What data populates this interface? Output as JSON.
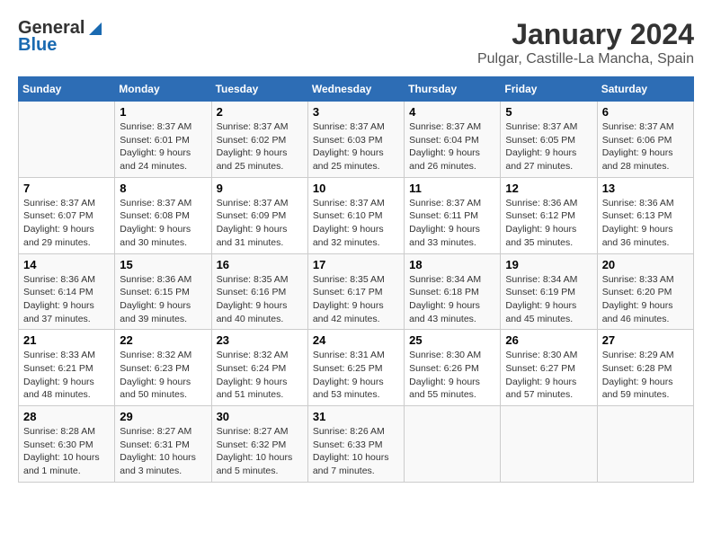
{
  "logo": {
    "general": "General",
    "blue": "Blue"
  },
  "title": "January 2024",
  "subtitle": "Pulgar, Castille-La Mancha, Spain",
  "days_of_week": [
    "Sunday",
    "Monday",
    "Tuesday",
    "Wednesday",
    "Thursday",
    "Friday",
    "Saturday"
  ],
  "weeks": [
    [
      {
        "num": "",
        "sunrise": "",
        "sunset": "",
        "daylight": ""
      },
      {
        "num": "1",
        "sunrise": "Sunrise: 8:37 AM",
        "sunset": "Sunset: 6:01 PM",
        "daylight": "Daylight: 9 hours and 24 minutes."
      },
      {
        "num": "2",
        "sunrise": "Sunrise: 8:37 AM",
        "sunset": "Sunset: 6:02 PM",
        "daylight": "Daylight: 9 hours and 25 minutes."
      },
      {
        "num": "3",
        "sunrise": "Sunrise: 8:37 AM",
        "sunset": "Sunset: 6:03 PM",
        "daylight": "Daylight: 9 hours and 25 minutes."
      },
      {
        "num": "4",
        "sunrise": "Sunrise: 8:37 AM",
        "sunset": "Sunset: 6:04 PM",
        "daylight": "Daylight: 9 hours and 26 minutes."
      },
      {
        "num": "5",
        "sunrise": "Sunrise: 8:37 AM",
        "sunset": "Sunset: 6:05 PM",
        "daylight": "Daylight: 9 hours and 27 minutes."
      },
      {
        "num": "6",
        "sunrise": "Sunrise: 8:37 AM",
        "sunset": "Sunset: 6:06 PM",
        "daylight": "Daylight: 9 hours and 28 minutes."
      }
    ],
    [
      {
        "num": "7",
        "sunrise": "Sunrise: 8:37 AM",
        "sunset": "Sunset: 6:07 PM",
        "daylight": "Daylight: 9 hours and 29 minutes."
      },
      {
        "num": "8",
        "sunrise": "Sunrise: 8:37 AM",
        "sunset": "Sunset: 6:08 PM",
        "daylight": "Daylight: 9 hours and 30 minutes."
      },
      {
        "num": "9",
        "sunrise": "Sunrise: 8:37 AM",
        "sunset": "Sunset: 6:09 PM",
        "daylight": "Daylight: 9 hours and 31 minutes."
      },
      {
        "num": "10",
        "sunrise": "Sunrise: 8:37 AM",
        "sunset": "Sunset: 6:10 PM",
        "daylight": "Daylight: 9 hours and 32 minutes."
      },
      {
        "num": "11",
        "sunrise": "Sunrise: 8:37 AM",
        "sunset": "Sunset: 6:11 PM",
        "daylight": "Daylight: 9 hours and 33 minutes."
      },
      {
        "num": "12",
        "sunrise": "Sunrise: 8:36 AM",
        "sunset": "Sunset: 6:12 PM",
        "daylight": "Daylight: 9 hours and 35 minutes."
      },
      {
        "num": "13",
        "sunrise": "Sunrise: 8:36 AM",
        "sunset": "Sunset: 6:13 PM",
        "daylight": "Daylight: 9 hours and 36 minutes."
      }
    ],
    [
      {
        "num": "14",
        "sunrise": "Sunrise: 8:36 AM",
        "sunset": "Sunset: 6:14 PM",
        "daylight": "Daylight: 9 hours and 37 minutes."
      },
      {
        "num": "15",
        "sunrise": "Sunrise: 8:36 AM",
        "sunset": "Sunset: 6:15 PM",
        "daylight": "Daylight: 9 hours and 39 minutes."
      },
      {
        "num": "16",
        "sunrise": "Sunrise: 8:35 AM",
        "sunset": "Sunset: 6:16 PM",
        "daylight": "Daylight: 9 hours and 40 minutes."
      },
      {
        "num": "17",
        "sunrise": "Sunrise: 8:35 AM",
        "sunset": "Sunset: 6:17 PM",
        "daylight": "Daylight: 9 hours and 42 minutes."
      },
      {
        "num": "18",
        "sunrise": "Sunrise: 8:34 AM",
        "sunset": "Sunset: 6:18 PM",
        "daylight": "Daylight: 9 hours and 43 minutes."
      },
      {
        "num": "19",
        "sunrise": "Sunrise: 8:34 AM",
        "sunset": "Sunset: 6:19 PM",
        "daylight": "Daylight: 9 hours and 45 minutes."
      },
      {
        "num": "20",
        "sunrise": "Sunrise: 8:33 AM",
        "sunset": "Sunset: 6:20 PM",
        "daylight": "Daylight: 9 hours and 46 minutes."
      }
    ],
    [
      {
        "num": "21",
        "sunrise": "Sunrise: 8:33 AM",
        "sunset": "Sunset: 6:21 PM",
        "daylight": "Daylight: 9 hours and 48 minutes."
      },
      {
        "num": "22",
        "sunrise": "Sunrise: 8:32 AM",
        "sunset": "Sunset: 6:23 PM",
        "daylight": "Daylight: 9 hours and 50 minutes."
      },
      {
        "num": "23",
        "sunrise": "Sunrise: 8:32 AM",
        "sunset": "Sunset: 6:24 PM",
        "daylight": "Daylight: 9 hours and 51 minutes."
      },
      {
        "num": "24",
        "sunrise": "Sunrise: 8:31 AM",
        "sunset": "Sunset: 6:25 PM",
        "daylight": "Daylight: 9 hours and 53 minutes."
      },
      {
        "num": "25",
        "sunrise": "Sunrise: 8:30 AM",
        "sunset": "Sunset: 6:26 PM",
        "daylight": "Daylight: 9 hours and 55 minutes."
      },
      {
        "num": "26",
        "sunrise": "Sunrise: 8:30 AM",
        "sunset": "Sunset: 6:27 PM",
        "daylight": "Daylight: 9 hours and 57 minutes."
      },
      {
        "num": "27",
        "sunrise": "Sunrise: 8:29 AM",
        "sunset": "Sunset: 6:28 PM",
        "daylight": "Daylight: 9 hours and 59 minutes."
      }
    ],
    [
      {
        "num": "28",
        "sunrise": "Sunrise: 8:28 AM",
        "sunset": "Sunset: 6:30 PM",
        "daylight": "Daylight: 10 hours and 1 minute."
      },
      {
        "num": "29",
        "sunrise": "Sunrise: 8:27 AM",
        "sunset": "Sunset: 6:31 PM",
        "daylight": "Daylight: 10 hours and 3 minutes."
      },
      {
        "num": "30",
        "sunrise": "Sunrise: 8:27 AM",
        "sunset": "Sunset: 6:32 PM",
        "daylight": "Daylight: 10 hours and 5 minutes."
      },
      {
        "num": "31",
        "sunrise": "Sunrise: 8:26 AM",
        "sunset": "Sunset: 6:33 PM",
        "daylight": "Daylight: 10 hours and 7 minutes."
      },
      {
        "num": "",
        "sunrise": "",
        "sunset": "",
        "daylight": ""
      },
      {
        "num": "",
        "sunrise": "",
        "sunset": "",
        "daylight": ""
      },
      {
        "num": "",
        "sunrise": "",
        "sunset": "",
        "daylight": ""
      }
    ]
  ]
}
